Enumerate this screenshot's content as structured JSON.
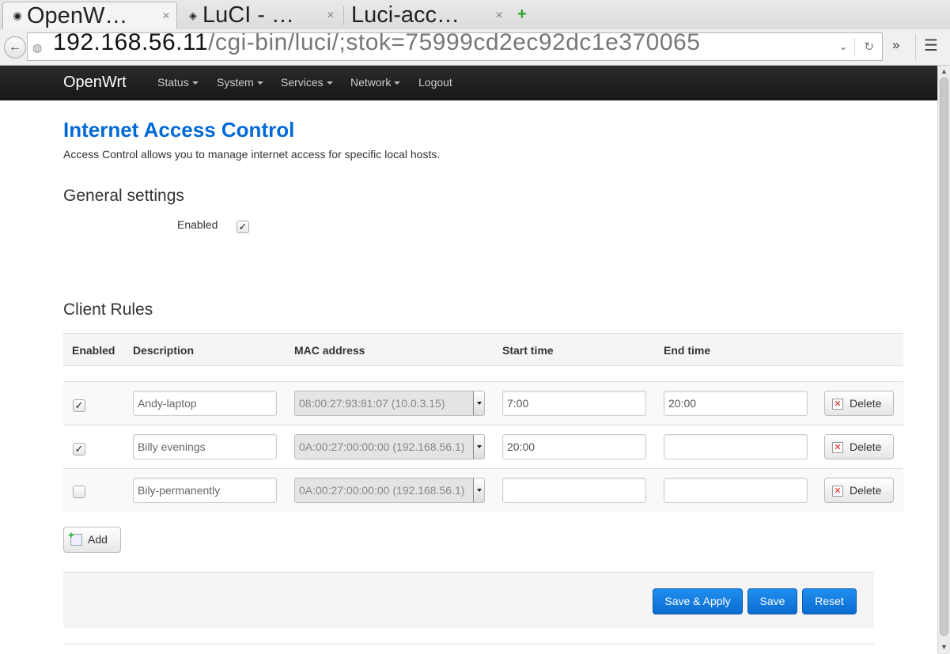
{
  "browser": {
    "tabs": [
      {
        "title": "OpenW…",
        "icon": "openwrt-tab-icon",
        "active": true
      },
      {
        "title": "LuCI - …",
        "icon": "luci-tab-icon",
        "active": false
      },
      {
        "title": "Luci-acc…",
        "icon": "",
        "active": false
      }
    ],
    "new_tab_symbol": "+",
    "url_host": "192.168.56.11",
    "url_path": "/cgi-bin/luci/;stok=75999cd2ec92dc1e370065",
    "overflow_symbol": "»",
    "menu_symbol": "☰"
  },
  "nav": {
    "brand": "OpenWrt",
    "items": [
      {
        "label": "Status",
        "has_caret": true
      },
      {
        "label": "System",
        "has_caret": true
      },
      {
        "label": "Services",
        "has_caret": true
      },
      {
        "label": "Network",
        "has_caret": true
      },
      {
        "label": "Logout",
        "has_caret": false
      }
    ]
  },
  "page": {
    "title": "Internet Access Control",
    "description": "Access Control allows you to manage internet access for specific local hosts.",
    "general_settings_title": "General settings",
    "enabled_label": "Enabled",
    "enabled_checked": true,
    "client_rules_title": "Client Rules"
  },
  "table": {
    "headers": {
      "enabled": "Enabled",
      "description": "Description",
      "mac": "MAC address",
      "start": "Start time",
      "end": "End time"
    },
    "rows": [
      {
        "enabled": true,
        "description": "Andy-laptop",
        "mac": "08:00:27:93:81:07 (10.0.3.15)",
        "start": "7:00",
        "end": "20:00"
      },
      {
        "enabled": true,
        "description": "Billy evenings",
        "mac": "0A:00:27:00:00:00 (192.168.56.1)",
        "start": "20:00",
        "end": ""
      },
      {
        "enabled": false,
        "description": "Bily-permanently",
        "mac": "0A:00:27:00:00:00 (192.168.56.1)",
        "start": "",
        "end": ""
      }
    ],
    "delete_label": "Delete",
    "add_label": "Add"
  },
  "actions": {
    "save_apply": "Save & Apply",
    "save": "Save",
    "reset": "Reset"
  },
  "colors": {
    "nav_bg": "#1b1b1b",
    "title_blue": "#0069d6",
    "primary_button": "#1584e6"
  }
}
